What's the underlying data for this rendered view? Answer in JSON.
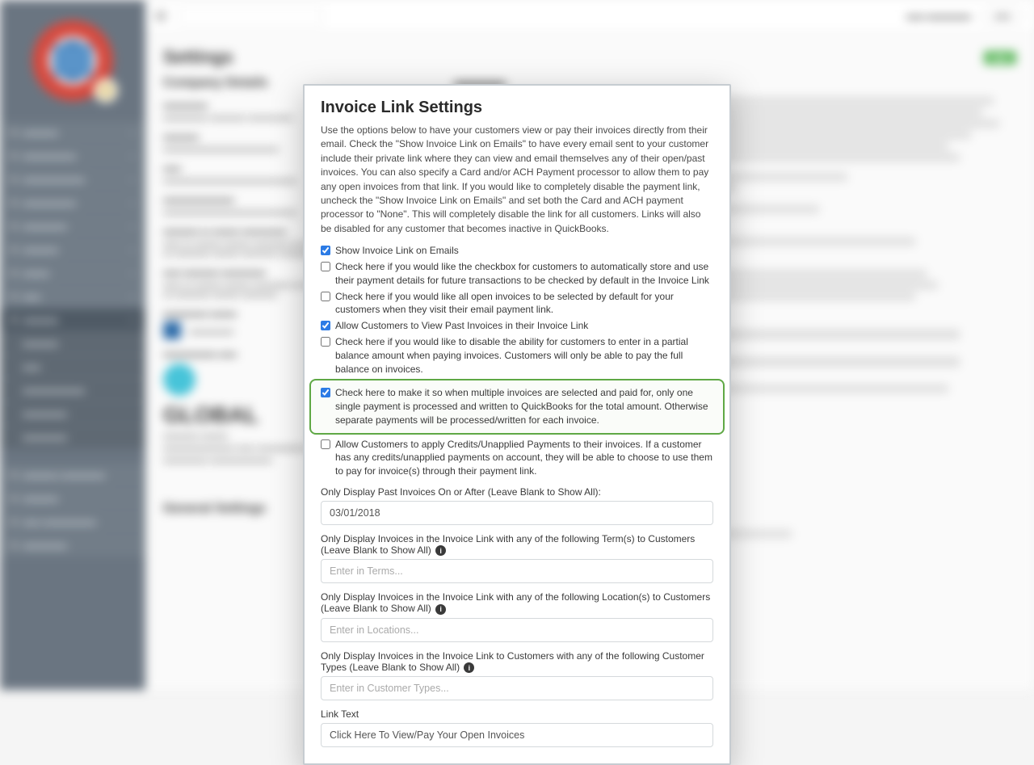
{
  "page": {
    "title": "Settings",
    "subtitle": ""
  },
  "modal": {
    "title": "Invoice Link Settings",
    "description": "Use the options below to have your customers view or pay their invoices directly from their email. Check the \"Show Invoice Link on Emails\" to have every email sent to your customer include their private link where they can view and email themselves any of their open/past invoices. You can also specify a Card and/or ACH Payment processor to allow them to pay any open invoices from that link. If you would like to completely disable the payment link, uncheck the \"Show Invoice Link on Emails\" and set both the Card and ACH payment processor to \"None\". This will completely disable the link for all customers. Links will also be disabled for any customer that becomes inactive in QuickBooks.",
    "checkboxes": [
      {
        "checked": true,
        "label": "Show Invoice Link on Emails"
      },
      {
        "checked": false,
        "label": "Check here if you would like the checkbox for customers to automatically store and use their payment details for future transactions to be checked by default in the Invoice Link"
      },
      {
        "checked": false,
        "label": "Check here if you would like all open invoices to be selected by default for your customers when they visit their email payment link."
      },
      {
        "checked": true,
        "label": "Allow Customers to View Past Invoices in their Invoice Link"
      },
      {
        "checked": false,
        "label": "Check here if you would like to disable the ability for customers to enter in a partial balance amount when paying invoices. Customers will only be able to pay the full balance on invoices."
      },
      {
        "checked": true,
        "label": "Check here to make it so when multiple invoices are selected and paid for, only one single payment is processed and written to QuickBooks for the total amount. Otherwise separate payments will be processed/written for each invoice."
      },
      {
        "checked": false,
        "label": "Allow Customers to apply Credits/Unapplied Payments to their invoices. If a customer has any credits/unapplied payments on account, they will be able to choose to use them to pay for invoice(s) through their payment link."
      }
    ],
    "fields": {
      "past_date_label": "Only Display Past Invoices On or After (Leave Blank to Show All):",
      "past_date_value": "03/01/2018",
      "terms_label": "Only Display Invoices in the Invoice Link with any of the following Term(s) to Customers (Leave Blank to Show All)",
      "terms_placeholder": "Enter in Terms...",
      "locations_label": "Only Display Invoices in the Invoice Link with any of the following Location(s) to Customers (Leave Blank to Show All)",
      "locations_placeholder": "Enter in Locations...",
      "ctypes_label": "Only Display Invoices in the Invoice Link to Customers with any of the following Customer Types (Leave Blank to Show All)",
      "ctypes_placeholder": "Enter in Customer Types...",
      "linktext_label": "Link Text",
      "linktext_value": "Click Here To View/Pay Your Open Invoices"
    }
  },
  "bg": {
    "company_details": "Company Details",
    "general_settings": "General Settings",
    "logo_text": "GLOBAL"
  }
}
